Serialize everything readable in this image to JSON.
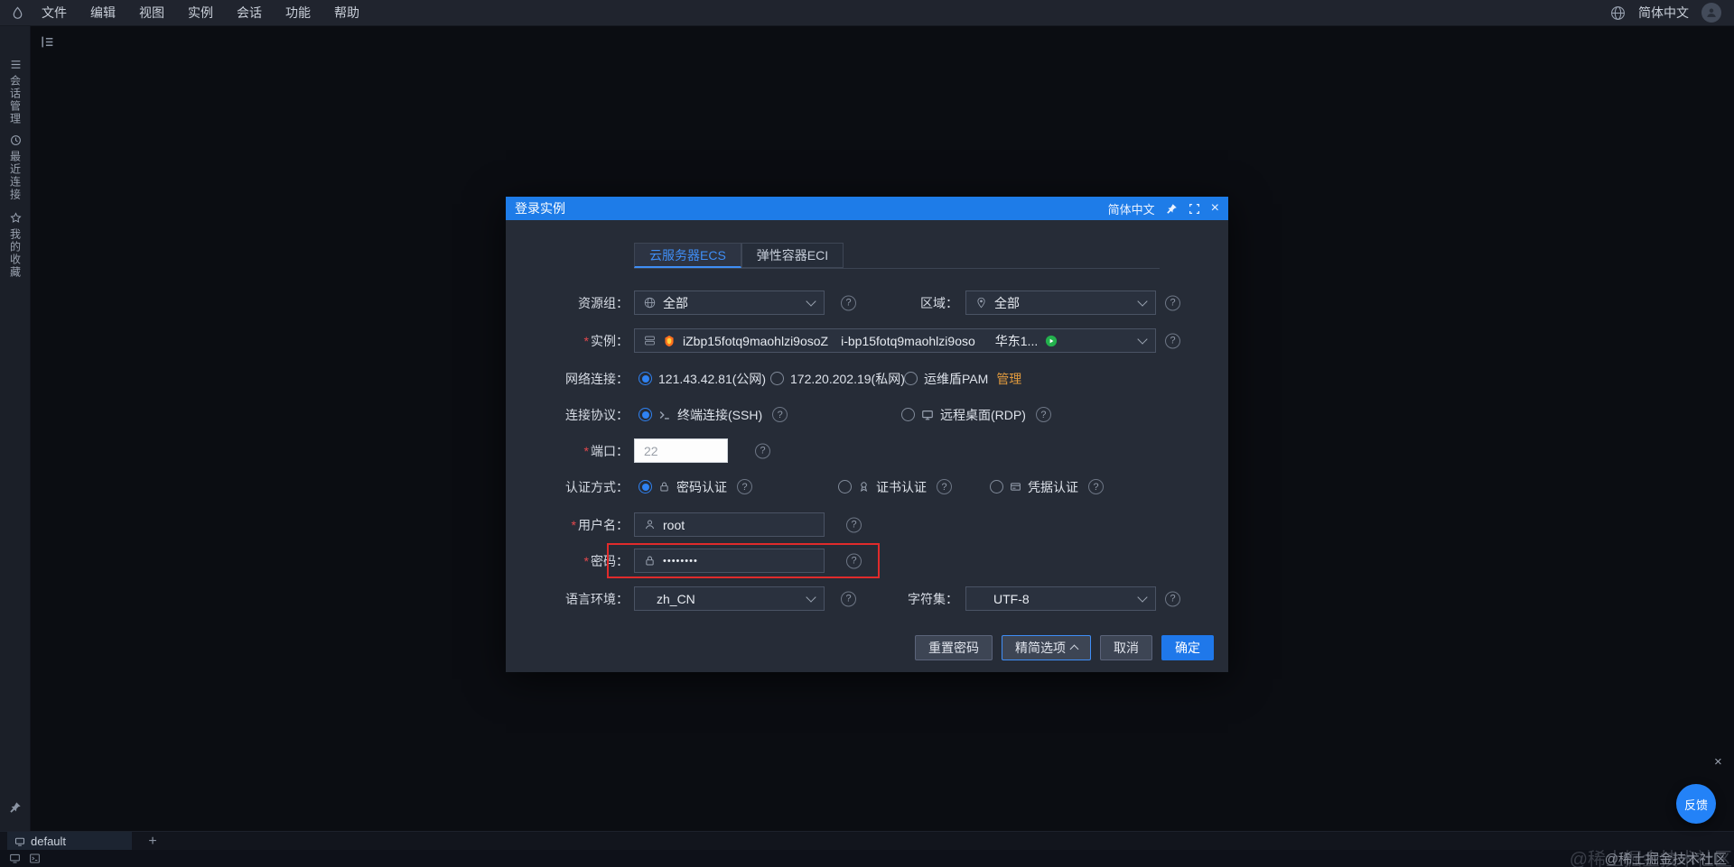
{
  "topbar": {
    "menu": [
      "文件",
      "编辑",
      "视图",
      "实例",
      "会话",
      "功能",
      "帮助"
    ],
    "language": "简体中文"
  },
  "sidebar": {
    "items": [
      "会话管理",
      "最近连接",
      "我的收藏"
    ]
  },
  "dialog": {
    "title": "登录实例",
    "language": "简体中文",
    "required": "*",
    "tabs": [
      "云服务器ECS",
      "弹性容器ECI"
    ],
    "resource_group": {
      "label": "资源组：",
      "value": "全部"
    },
    "region": {
      "label": "区域：",
      "value": "全部"
    },
    "instance": {
      "label": "实例：",
      "name": "iZbp15fotq9maohlzi9osoZ",
      "id": "i-bp15fotq9maohlzi9oso",
      "zone": "华东1..."
    },
    "network": {
      "label": "网络连接：",
      "options": [
        "121.43.42.81(公网)",
        "172.20.202.19(私网)",
        "运维盾PAM"
      ],
      "manage": "管理"
    },
    "protocol": {
      "label": "连接协议：",
      "options": [
        "终端连接(SSH)",
        "远程桌面(RDP)"
      ]
    },
    "port": {
      "label": "端口：",
      "value": "22"
    },
    "auth": {
      "label": "认证方式：",
      "options": [
        "密码认证",
        "证书认证",
        "凭据认证"
      ]
    },
    "username": {
      "label": "用户名：",
      "value": "root"
    },
    "password": {
      "label": "密码：",
      "value": "••••••••"
    },
    "locale": {
      "label": "语言环境：",
      "value": "zh_CN"
    },
    "charset": {
      "label": "字符集：",
      "value": "UTF-8"
    },
    "buttons": {
      "reset": "重置密码",
      "simple": "精简选项",
      "cancel": "取消",
      "ok": "确定"
    }
  },
  "bottom": {
    "tab": "default",
    "watermark": "@稀土掘金技术社区",
    "feedback": "反馈"
  },
  "icons": {
    "help": "?",
    "close": "×",
    "plus": "+"
  },
  "colors": {
    "accent": "#1e7ce8",
    "highlight": "#e02b2b",
    "link": "#e09a3e",
    "success": "#23b14d"
  }
}
